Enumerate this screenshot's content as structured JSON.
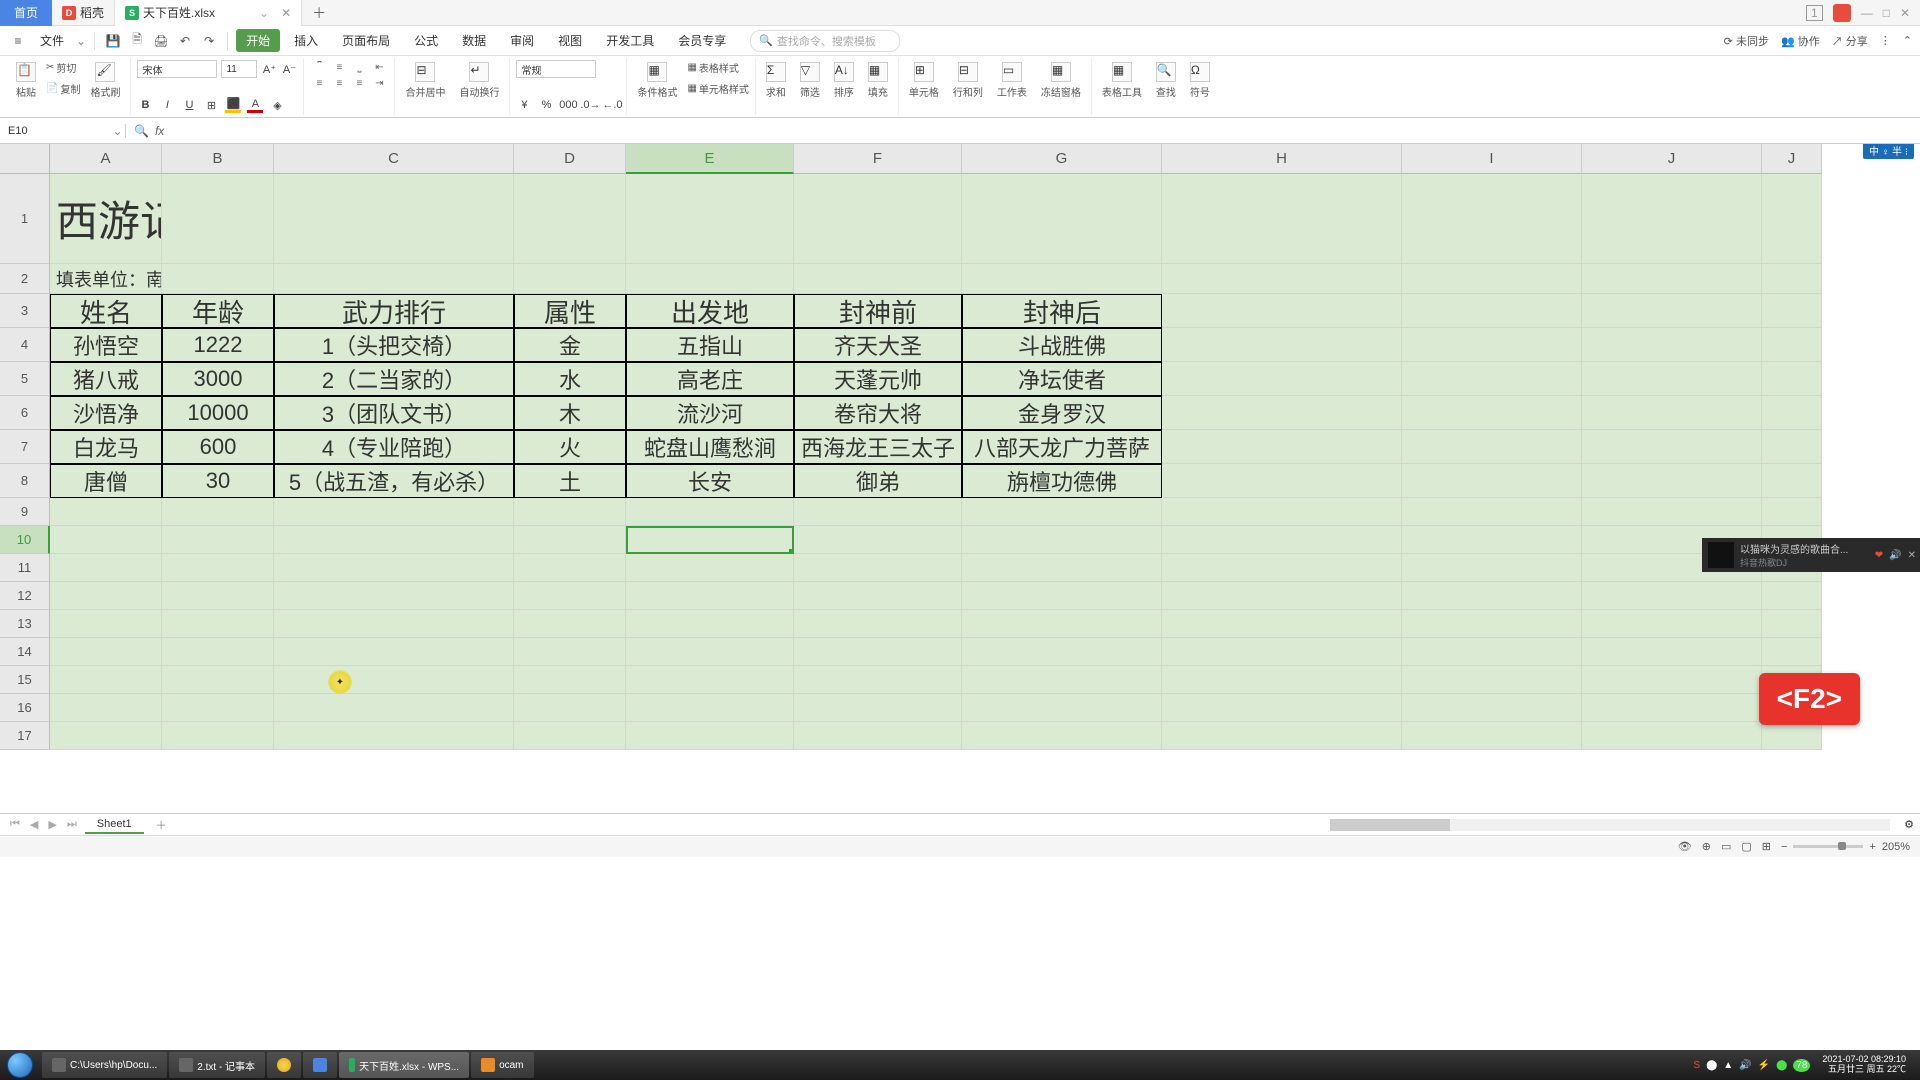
{
  "tabs": {
    "home": "首页",
    "doc1_icon": "D",
    "doc1": "稻壳",
    "doc2_icon": "S",
    "doc2": "天下百姓.xlsx"
  },
  "win_icons": {
    "one": "1",
    "min": "—",
    "max": "□",
    "close": "✕"
  },
  "menu": {
    "file": "文件",
    "start": "开始",
    "insert": "插入",
    "layout": "页面布局",
    "formula": "公式",
    "data": "数据",
    "review": "审阅",
    "view": "视图",
    "dev": "开发工具",
    "member": "会员专享",
    "search_placeholder": "查找命令、搜索模板",
    "right": {
      "unsync": "未同步",
      "collab": "协作",
      "share": "分享"
    }
  },
  "ribbon": {
    "paste": "粘贴",
    "cut": "剪切",
    "copy": "复制",
    "formatbrush": "格式刷",
    "font_name": "宋体",
    "font_size": "11",
    "merge": "合并居中",
    "wrap": "自动换行",
    "numfmt": "常规",
    "condfmt": "条件格式",
    "cellstyle": "单元格样式",
    "tablestyle": "表格样式",
    "sum": "求和",
    "filter": "筛选",
    "sort": "排序",
    "fill": "填充",
    "cell": "单元格",
    "rowcol": "行和列",
    "sheet": "工作表",
    "freeze": "冻结窗格",
    "tabletool": "表格工具",
    "find": "查找",
    "symbol": "符号"
  },
  "namebox": "E10",
  "cols": [
    "A",
    "B",
    "C",
    "D",
    "E",
    "F",
    "G",
    "H",
    "I",
    "J"
  ],
  "title": "西游记封神簿",
  "subtitle": "填表单位：南天门",
  "headers": [
    "姓名",
    "年龄",
    "武力排行",
    "属性",
    "出发地",
    "封神前",
    "封神后"
  ],
  "rows": [
    [
      "孙悟空",
      "1222",
      "1（头把交椅）",
      "金",
      "五指山",
      "齐天大圣",
      "斗战胜佛"
    ],
    [
      "猪八戒",
      "3000",
      "2（二当家的）",
      "水",
      "高老庄",
      "天蓬元帅",
      "净坛使者"
    ],
    [
      "沙悟净",
      "10000",
      "3（团队文书）",
      "木",
      "流沙河",
      "卷帘大将",
      "金身罗汉"
    ],
    [
      "白龙马",
      "600",
      "4（专业陪跑）",
      "火",
      "蛇盘山鹰愁涧",
      "西海龙王三太子",
      "八部天龙广力菩萨"
    ],
    [
      "唐僧",
      "30",
      "5（战五渣，有必杀）",
      "土",
      "长安",
      "御弟",
      "旃檀功德佛"
    ]
  ],
  "sheet_tab": "Sheet1",
  "zoom": "205%",
  "f2": "<F2>",
  "music": {
    "title": "以猫咪为灵感的歌曲合...",
    "sub": "抖音热歌DJ"
  },
  "taskbar": {
    "items": [
      "C:\\Users\\hp\\Docu...",
      "2.txt - 记事本",
      "",
      "",
      "天下百姓.xlsx - WPS...",
      "ocam"
    ],
    "clock1": "2021-07-02 08:29:10",
    "clock2": "五月廿三 周五 22℃"
  },
  "ime": "中 ♀ 半 ⁝"
}
